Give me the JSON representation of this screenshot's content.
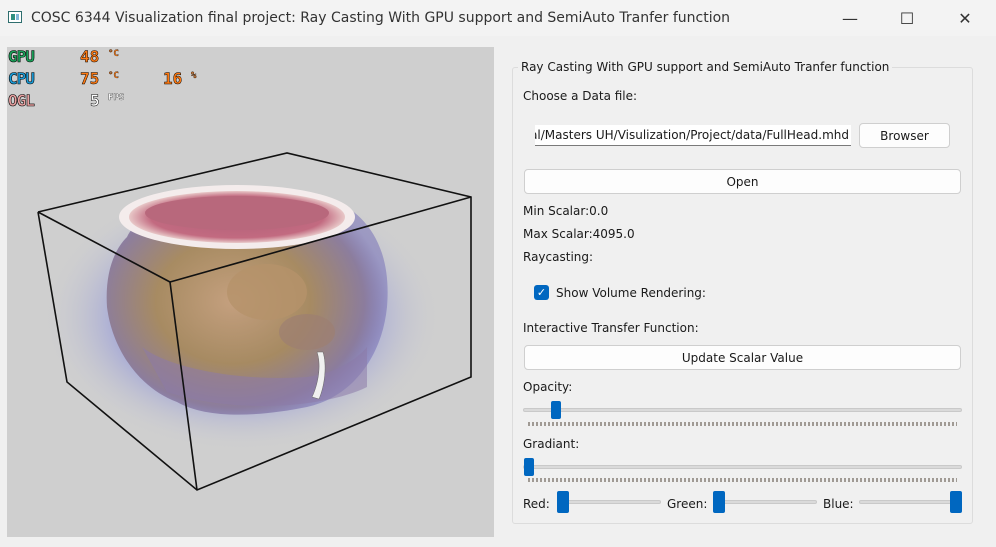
{
  "window": {
    "title": "COSC 6344 Visualization final project: Ray Casting With GPU support and SemiAuto Tranfer function",
    "controls": {
      "minimize": "—",
      "maximize": "☐",
      "close": "✕"
    }
  },
  "hud": {
    "gpu_label": "GPU",
    "gpu_value": "48",
    "gpu_unit": "°C",
    "cpu_label": "CPU",
    "cpu_value": "75",
    "cpu_unit": "°C",
    "cpu_usage": "16",
    "cpu_usage_unit": "%",
    "ogl_label": "OGL",
    "fps_value": "5",
    "fps_unit": "FPS"
  },
  "panel": {
    "group_title": "Ray Casting With GPU support and SemiAuto Tranfer function",
    "choose_label": "Choose a Data file:",
    "file_path": "rial/Masters UH/Visulization/Project/data/FullHead.mhd",
    "browse_label": "Browser",
    "open_label": "Open",
    "min_scalar": "Min Scalar:0.0",
    "max_scalar": "Max Scalar:4095.0",
    "raycasting_label": "Raycasting:",
    "show_volume_label": "Show Volume Rendering:",
    "show_volume_checked": true,
    "tf_label": "Interactive Transfer Function:",
    "update_label": "Update Scalar Value",
    "opacity_label": "Opacity:",
    "opacity_value": 0.04,
    "gradient_label": "Gradiant:",
    "gradient_value": 0.0,
    "red_label": "Red:",
    "red_value": 0.0,
    "green_label": "Green:",
    "green_value": 0.0,
    "blue_label": "Blue:",
    "blue_value": 1.0
  },
  "colors": {
    "accent": "#0067c0",
    "hud_gpu": "#1aa35a",
    "hud_cpu": "#1a9bd7",
    "hud_ogl": "#e8a0a0",
    "hud_value": "#ff7a12"
  }
}
